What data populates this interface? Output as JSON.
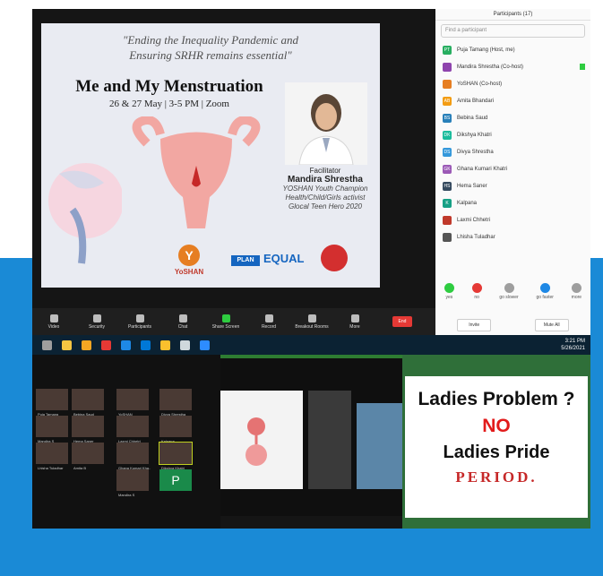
{
  "slide": {
    "quote_line1": "\"Ending the Inequality Pandemic and",
    "quote_line2": "Ensuring SRHR remains essential\"",
    "title": "Me and My Menstruation",
    "date": "26 & 27 May | 3-5 PM | Zoom",
    "facilitator_label": "Facilitator",
    "facilitator_name": "Mandira Shrestha",
    "facilitator_role1": "YOSHAN Youth Champion",
    "facilitator_role2": "Health/Child/Girls activist",
    "facilitator_role3": "Glocal Teen Hero 2020",
    "logo_yoshan": "YoSHAN",
    "logo_plan": "PLAN",
    "logo_equal": "EQUAL"
  },
  "participants_panel": {
    "title": "Participants (17)",
    "search_placeholder": "Find a participant",
    "items": [
      {
        "name": "Puja Tamang (Host, me)",
        "initials": "PT",
        "color": "#27ae60"
      },
      {
        "name": "Mandira Shrestha (Co-host)",
        "initials": "",
        "color": "#8e44ad"
      },
      {
        "name": "YoSHAN (Co-host)",
        "initials": "",
        "color": "#e67e22"
      },
      {
        "name": "Amita Bhandari",
        "initials": "AB",
        "color": "#f39c12"
      },
      {
        "name": "Bebina Saud",
        "initials": "BS",
        "color": "#2980b9"
      },
      {
        "name": "Dikshya Khatri",
        "initials": "DK",
        "color": "#1abc9c"
      },
      {
        "name": "Divya Shrestha",
        "initials": "DS",
        "color": "#3498db"
      },
      {
        "name": "Ghana Kumari Khatri",
        "initials": "GK",
        "color": "#9b59b6"
      },
      {
        "name": "Hema Saner",
        "initials": "HS",
        "color": "#34495e"
      },
      {
        "name": "Kalpana",
        "initials": "K",
        "color": "#16a085"
      },
      {
        "name": "Laxmi Chhetri",
        "initials": "",
        "color": "#c0392b"
      },
      {
        "name": "Lhisha Tuladhar",
        "initials": "",
        "color": "#555555"
      }
    ],
    "reactions": [
      "yes",
      "no",
      "go slower",
      "go faster",
      "more"
    ],
    "invite_label": "Invite",
    "mute_all_label": "Mute All"
  },
  "toolbar": {
    "buttons": [
      "Video",
      "Security",
      "Participants",
      "Chat",
      "Share Screen",
      "Record",
      "Breakout Rooms",
      "More"
    ],
    "participant_count": "17",
    "end_label": "End"
  },
  "taskbar": {
    "time": "3:21 PM",
    "date": "5/26/2021"
  },
  "gallery": {
    "tiles": [
      "Puja Tamang",
      "Bebina Saud",
      "YoSHAN",
      "Divya Shrestha",
      "Mandira S",
      "Hema Saner",
      "Laxmi Chhetri",
      "Kalpana",
      "Lhisha Tuladhar",
      "Amita B",
      "Ghana Kumari Kha..",
      "Dikshya Khatri",
      "Mandira S",
      "P"
    ]
  },
  "poster": {
    "line1": "Ladies Problem ?",
    "line2": "NO",
    "line3": "Ladies Pride",
    "line4": "PERIOD."
  }
}
